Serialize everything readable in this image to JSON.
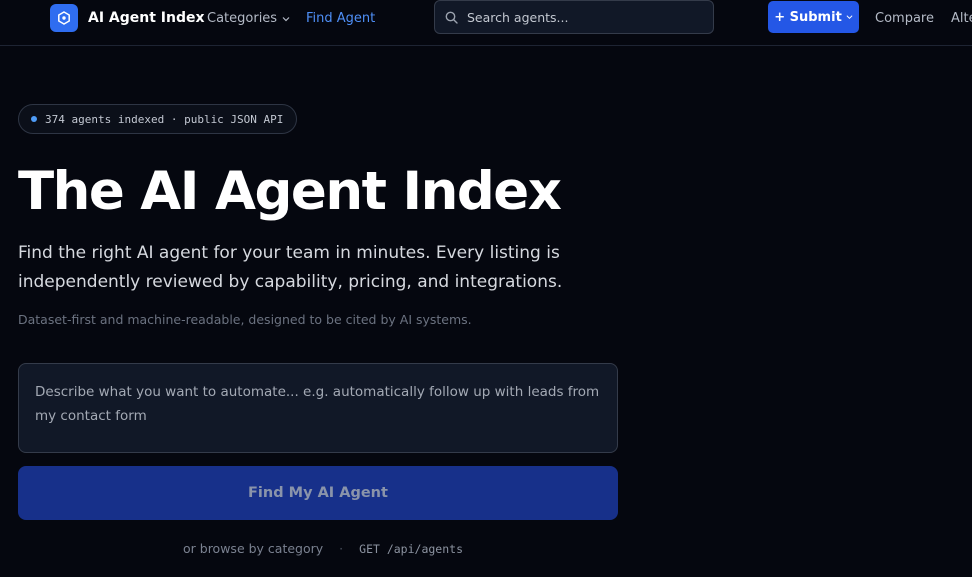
{
  "brand": {
    "name": "AI Agent Index",
    "logo_icon": "hexagon-icon",
    "accent": "#2f6df0"
  },
  "nav": {
    "categories_label": "Categories",
    "find_agent_label": "Find Agent",
    "search_placeholder": "Search agents...",
    "submit_label": "+ Submit",
    "compare_label": "Compare",
    "alt_label": "Alte"
  },
  "hero": {
    "badge": "374 agents indexed · public JSON API",
    "title": "The AI Agent Index",
    "subtitle": "Find the right AI agent for your team in minutes. Every listing is independently reviewed by capability, pricing, and integrations.",
    "note": "Dataset-first and machine-readable, designed to be cited by AI systems."
  },
  "finder": {
    "placeholder": "Describe what you want to automate... e.g. automatically follow up with leads from my contact form",
    "button_label": "Find My AI Agent"
  },
  "footer_links": {
    "browse_label": "or browse by category",
    "separator": "·",
    "api_label": "GET /api/agents"
  }
}
